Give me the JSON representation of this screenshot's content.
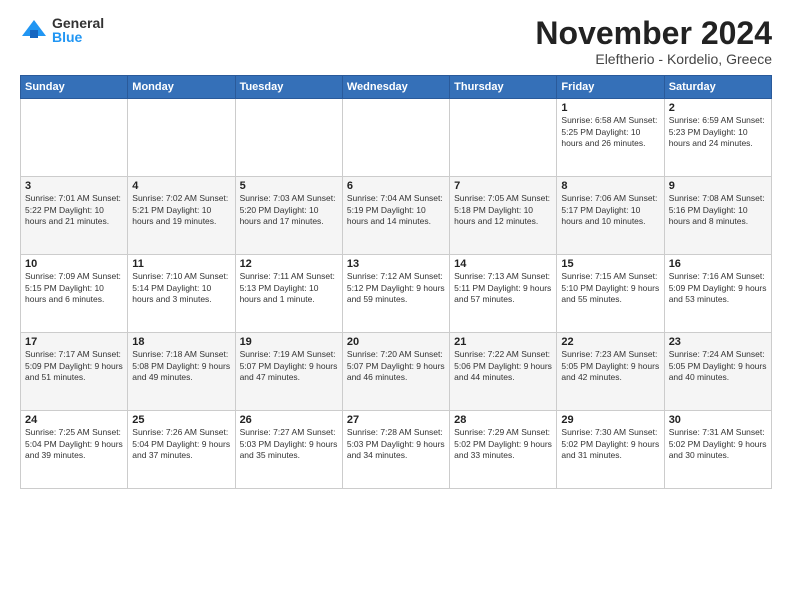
{
  "logo": {
    "general": "General",
    "blue": "Blue"
  },
  "title": "November 2024",
  "subtitle": "Eleftherio - Kordelio, Greece",
  "days_header": [
    "Sunday",
    "Monday",
    "Tuesday",
    "Wednesday",
    "Thursday",
    "Friday",
    "Saturday"
  ],
  "weeks": [
    [
      {
        "day": "",
        "info": ""
      },
      {
        "day": "",
        "info": ""
      },
      {
        "day": "",
        "info": ""
      },
      {
        "day": "",
        "info": ""
      },
      {
        "day": "",
        "info": ""
      },
      {
        "day": "1",
        "info": "Sunrise: 6:58 AM\nSunset: 5:25 PM\nDaylight: 10 hours\nand 26 minutes."
      },
      {
        "day": "2",
        "info": "Sunrise: 6:59 AM\nSunset: 5:23 PM\nDaylight: 10 hours\nand 24 minutes."
      }
    ],
    [
      {
        "day": "3",
        "info": "Sunrise: 7:01 AM\nSunset: 5:22 PM\nDaylight: 10 hours\nand 21 minutes."
      },
      {
        "day": "4",
        "info": "Sunrise: 7:02 AM\nSunset: 5:21 PM\nDaylight: 10 hours\nand 19 minutes."
      },
      {
        "day": "5",
        "info": "Sunrise: 7:03 AM\nSunset: 5:20 PM\nDaylight: 10 hours\nand 17 minutes."
      },
      {
        "day": "6",
        "info": "Sunrise: 7:04 AM\nSunset: 5:19 PM\nDaylight: 10 hours\nand 14 minutes."
      },
      {
        "day": "7",
        "info": "Sunrise: 7:05 AM\nSunset: 5:18 PM\nDaylight: 10 hours\nand 12 minutes."
      },
      {
        "day": "8",
        "info": "Sunrise: 7:06 AM\nSunset: 5:17 PM\nDaylight: 10 hours\nand 10 minutes."
      },
      {
        "day": "9",
        "info": "Sunrise: 7:08 AM\nSunset: 5:16 PM\nDaylight: 10 hours\nand 8 minutes."
      }
    ],
    [
      {
        "day": "10",
        "info": "Sunrise: 7:09 AM\nSunset: 5:15 PM\nDaylight: 10 hours\nand 6 minutes."
      },
      {
        "day": "11",
        "info": "Sunrise: 7:10 AM\nSunset: 5:14 PM\nDaylight: 10 hours\nand 3 minutes."
      },
      {
        "day": "12",
        "info": "Sunrise: 7:11 AM\nSunset: 5:13 PM\nDaylight: 10 hours\nand 1 minute."
      },
      {
        "day": "13",
        "info": "Sunrise: 7:12 AM\nSunset: 5:12 PM\nDaylight: 9 hours\nand 59 minutes."
      },
      {
        "day": "14",
        "info": "Sunrise: 7:13 AM\nSunset: 5:11 PM\nDaylight: 9 hours\nand 57 minutes."
      },
      {
        "day": "15",
        "info": "Sunrise: 7:15 AM\nSunset: 5:10 PM\nDaylight: 9 hours\nand 55 minutes."
      },
      {
        "day": "16",
        "info": "Sunrise: 7:16 AM\nSunset: 5:09 PM\nDaylight: 9 hours\nand 53 minutes."
      }
    ],
    [
      {
        "day": "17",
        "info": "Sunrise: 7:17 AM\nSunset: 5:09 PM\nDaylight: 9 hours\nand 51 minutes."
      },
      {
        "day": "18",
        "info": "Sunrise: 7:18 AM\nSunset: 5:08 PM\nDaylight: 9 hours\nand 49 minutes."
      },
      {
        "day": "19",
        "info": "Sunrise: 7:19 AM\nSunset: 5:07 PM\nDaylight: 9 hours\nand 47 minutes."
      },
      {
        "day": "20",
        "info": "Sunrise: 7:20 AM\nSunset: 5:07 PM\nDaylight: 9 hours\nand 46 minutes."
      },
      {
        "day": "21",
        "info": "Sunrise: 7:22 AM\nSunset: 5:06 PM\nDaylight: 9 hours\nand 44 minutes."
      },
      {
        "day": "22",
        "info": "Sunrise: 7:23 AM\nSunset: 5:05 PM\nDaylight: 9 hours\nand 42 minutes."
      },
      {
        "day": "23",
        "info": "Sunrise: 7:24 AM\nSunset: 5:05 PM\nDaylight: 9 hours\nand 40 minutes."
      }
    ],
    [
      {
        "day": "24",
        "info": "Sunrise: 7:25 AM\nSunset: 5:04 PM\nDaylight: 9 hours\nand 39 minutes."
      },
      {
        "day": "25",
        "info": "Sunrise: 7:26 AM\nSunset: 5:04 PM\nDaylight: 9 hours\nand 37 minutes."
      },
      {
        "day": "26",
        "info": "Sunrise: 7:27 AM\nSunset: 5:03 PM\nDaylight: 9 hours\nand 35 minutes."
      },
      {
        "day": "27",
        "info": "Sunrise: 7:28 AM\nSunset: 5:03 PM\nDaylight: 9 hours\nand 34 minutes."
      },
      {
        "day": "28",
        "info": "Sunrise: 7:29 AM\nSunset: 5:02 PM\nDaylight: 9 hours\nand 33 minutes."
      },
      {
        "day": "29",
        "info": "Sunrise: 7:30 AM\nSunset: 5:02 PM\nDaylight: 9 hours\nand 31 minutes."
      },
      {
        "day": "30",
        "info": "Sunrise: 7:31 AM\nSunset: 5:02 PM\nDaylight: 9 hours\nand 30 minutes."
      }
    ]
  ]
}
